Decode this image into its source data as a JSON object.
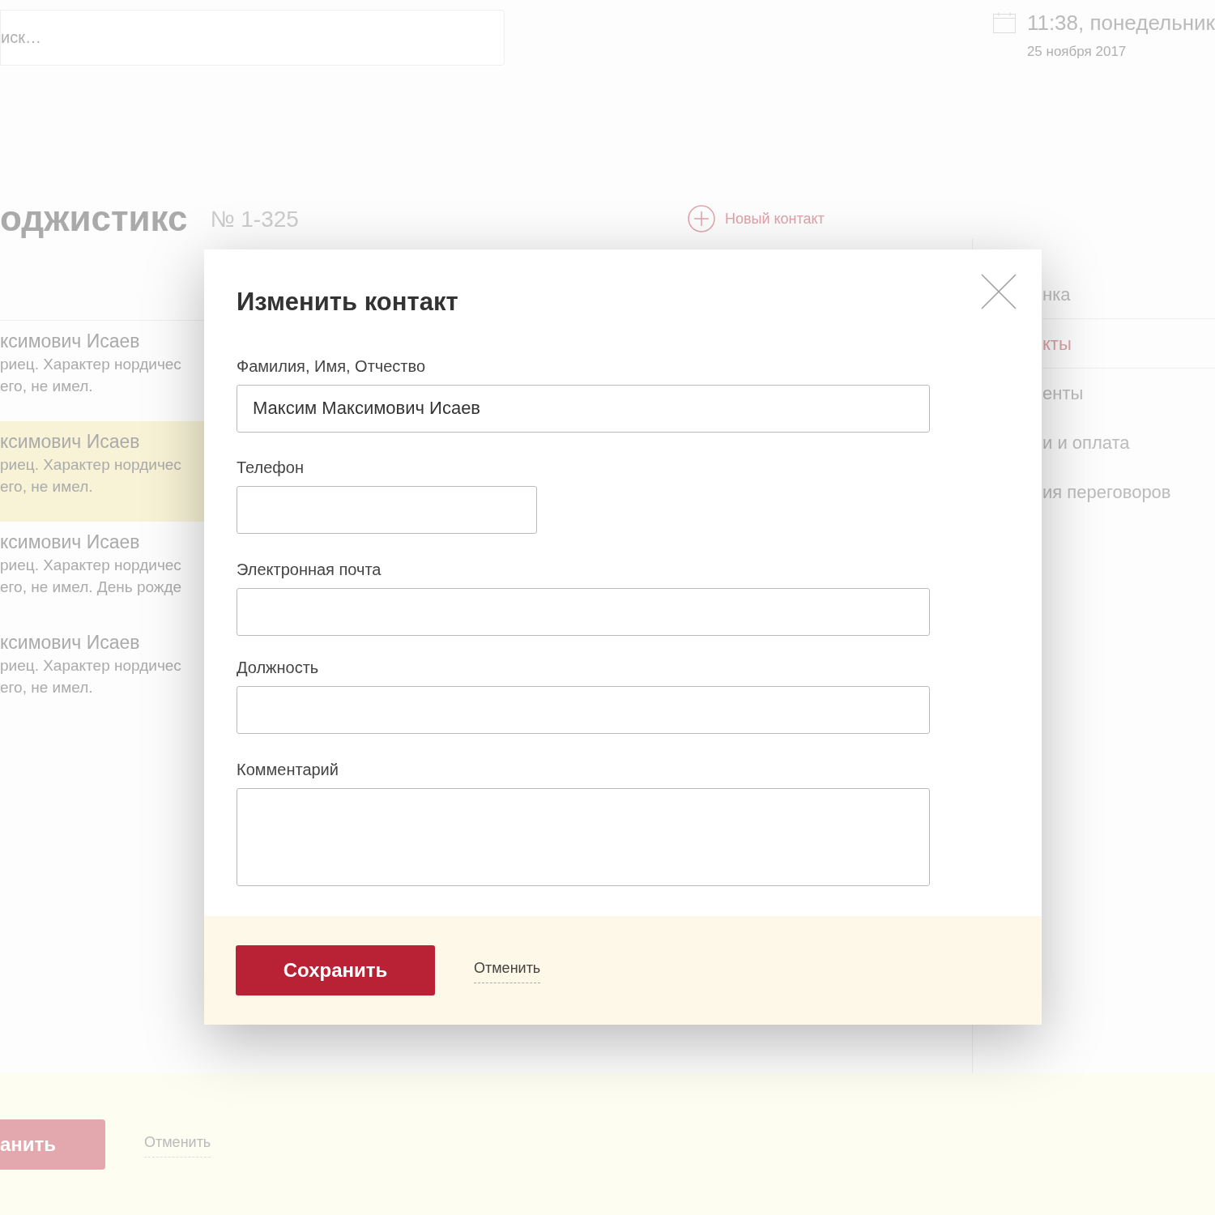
{
  "header": {
    "search": {
      "placeholder": "иск…"
    },
    "time": "11:38, понедельник",
    "date": "25 ноября 2017"
  },
  "page": {
    "title": "оджистикс",
    "number": "№ 1-325",
    "new_contact": "Новый контакт"
  },
  "contacts": [
    {
      "name": "ксимович Исаев",
      "note_lines": [
        "риец. Характер нордичес",
        "его, не имел."
      ],
      "selected": false
    },
    {
      "name": "ксимович Исаев",
      "note_lines": [
        "риец. Характер нордичес",
        "его, не имел."
      ],
      "selected": true
    },
    {
      "name": "ксимович Исаев",
      "note_lines": [
        "риец. Характер нордичес",
        "его, не имел. День рожде"
      ],
      "selected": false
    },
    {
      "name": "ксимович Исаев",
      "note_lines": [
        "риец. Характер нордичес",
        "его, не имел."
      ],
      "selected": false
    }
  ],
  "nav": [
    {
      "label": "нка",
      "selected": false
    },
    {
      "label": "кты",
      "selected": true
    },
    {
      "label": "енты",
      "selected": false
    },
    {
      "label": "и и оплата",
      "selected": false
    },
    {
      "label": "ия переговоров",
      "selected": false
    }
  ],
  "footer": {
    "save": "анить",
    "cancel": "Отменить"
  },
  "modal": {
    "title": "Изменить контакт",
    "fields": [
      {
        "label": "Фамилия, Имя, Отчество",
        "value": "Максим Максимович Исаев",
        "kind": "wide"
      },
      {
        "label": "Телефон",
        "kind": "short"
      },
      {
        "label": "Электронная почта",
        "kind": "wide"
      },
      {
        "label": "Должность",
        "kind": "wide"
      },
      {
        "label": "Комментарий",
        "kind": "textarea"
      }
    ],
    "save": "Сохранить",
    "cancel": "Отменить"
  }
}
